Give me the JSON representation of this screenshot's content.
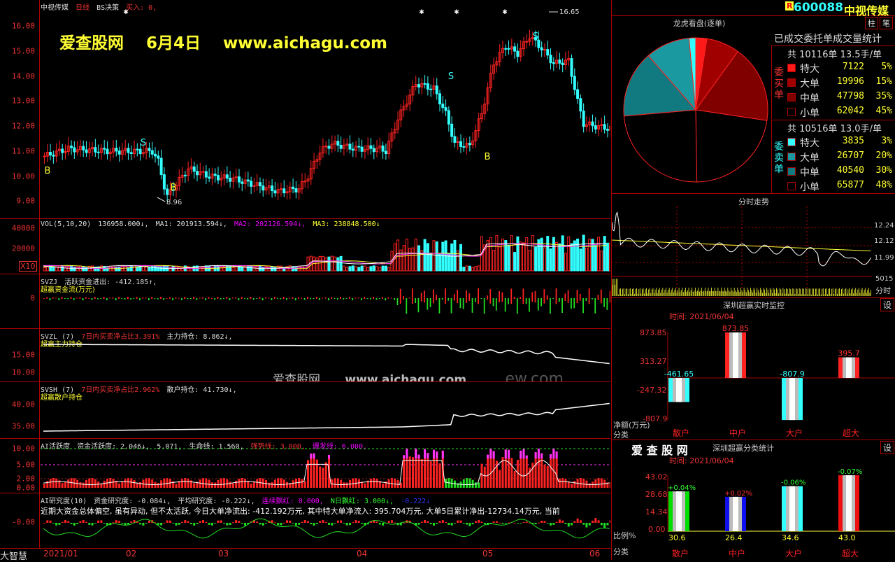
{
  "main_chart": {
    "stock_name": "中视传媒",
    "period": "日线",
    "strategy": "BS决策",
    "buy_text": "买入: 0,",
    "watermark_site": "爱查股网",
    "watermark_date": "6月4日",
    "watermark_url": "www.aichagu.com",
    "price_ticks": [
      "16.00",
      "15.00",
      "14.00",
      "13.00",
      "12.00",
      "11.00",
      "10.00",
      "9.00"
    ],
    "high_label": "16.65",
    "low_label": "8.96",
    "signals": [
      {
        "type": "B",
        "label": "B"
      },
      {
        "type": "B",
        "label": "B"
      },
      {
        "type": "S",
        "label": "S"
      },
      {
        "type": "S",
        "label": "S"
      },
      {
        "type": "B",
        "label": "B"
      },
      {
        "type": "S",
        "label": "S"
      }
    ]
  },
  "vol_pane": {
    "title": "VOL(5,10,20)",
    "value": "136958.000↓,",
    "ma1": "MA1: 201913.594↓,",
    "ma2": "MA2: 202126.594↓,",
    "ma3": "MA3: 238848.500↓",
    "ticks": [
      "40000",
      "20000"
    ],
    "unit": "X10"
  },
  "svzj_pane": {
    "title": "SVZJ",
    "line1": "活跃资金进出: -412.185↑,",
    "line2": "超赢资金流(万元)",
    "ticks": [
      "0"
    ]
  },
  "svzl_pane": {
    "title": "SVZL (7)",
    "ratio": "7日内买卖净占比3.391%",
    "hold": "主力持仓: 8.862↓,",
    "line2": "超赢主力持仓",
    "ticks": [
      "15.00",
      "10.00"
    ],
    "watermark": "爱查股网",
    "watermark_url": "www.aichagu.com",
    "watermark_faint": "ew.com"
  },
  "svsh_pane": {
    "title": "SVSH (7)",
    "ratio": "7日内买卖净占比2.962%",
    "hold": "散户持仓: 41.730↓,",
    "line2": "超赢散户持仓",
    "ticks": [
      "40.00",
      "35.00"
    ]
  },
  "ai_active_pane": {
    "title": "AI活跃度",
    "v1": "资金活跃度: 2.046↓,",
    "v2": "5.071,",
    "v3": "生命线: 1.560,",
    "v4": "强势线: 3.000,",
    "v5": "爆发线: 6.000,",
    "ticks": [
      "10.00",
      "5.00",
      "2.00",
      "0.00"
    ]
  },
  "ai_research_pane": {
    "title": "AI研究度(10)",
    "v1": "资金研究度: -0.084↓,",
    "v2": "平均研究度: -0.222↓,",
    "v3": "连续飘红: 0.000,",
    "v4": "N日飘红: 3.000↓,",
    "v5": "-0.222↓",
    "comment": "近期大资金总体偏空, 虽有异动, 但不太活跃, 今日大单净流出: -412.192万元, 其中特大单净流入: 395.704万元, 大单5日累计净出-12734.14万元, 当前",
    "ticks": [
      "-0.00"
    ]
  },
  "x_axis": {
    "app_label": "大智慧",
    "labels": [
      "2021/01",
      "02",
      "03",
      "04",
      "05",
      "06"
    ]
  },
  "right_header": {
    "badge": "R",
    "code": "600088",
    "name": "中视传媒",
    "btn1": "柱",
    "btn2": "笔"
  },
  "dragon_tiger": {
    "title": "龙虎看盘(逐单)",
    "subtitle": "已成交委托单成交量统计",
    "buy_header": "共 10116单 13.5手/单",
    "buy_side_label": "委买单",
    "buy_rows": [
      {
        "name": "特大",
        "count": "7122",
        "pct": "5%",
        "color": "#ff1a1a"
      },
      {
        "name": "大单",
        "count": "19996",
        "pct": "15%",
        "color": "#a00000"
      },
      {
        "name": "中单",
        "count": "47798",
        "pct": "35%",
        "color": "#800000"
      },
      {
        "name": "小单",
        "count": "62042",
        "pct": "45%",
        "color": "#000000"
      }
    ],
    "sell_header": "共 10516单 13.0手/单",
    "sell_side_label": "委卖单",
    "sell_rows": [
      {
        "name": "特大",
        "count": "3835",
        "pct": "3%",
        "color": "#33ffff"
      },
      {
        "name": "大单",
        "count": "26707",
        "pct": "20%",
        "color": "#1a9aa0"
      },
      {
        "name": "中单",
        "count": "40540",
        "pct": "30%",
        "color": "#107a80"
      },
      {
        "name": "小单",
        "count": "65877",
        "pct": "48%",
        "color": "#000000"
      }
    ]
  },
  "intraday": {
    "title": "分时走势",
    "ticks": [
      "12.24",
      "12.12",
      "11.99"
    ],
    "vol_tick": "5015",
    "vol_label": "分时"
  },
  "realtime_monitor": {
    "title": "深圳超赢实时监控",
    "setting_btn": "设",
    "time": "时间: 2021/06/04",
    "ticks": [
      "873.85",
      "313.27",
      "-247.32",
      "-807.9"
    ],
    "y_label": "净额(万元)",
    "x_label": "分类",
    "bars": [
      {
        "cat": "散户",
        "value": -461.65,
        "label": "-461.65"
      },
      {
        "cat": "中户",
        "value": 873.85,
        "label": "873.85"
      },
      {
        "cat": "大户",
        "value": -807.9,
        "label": "-807.9"
      },
      {
        "cat": "超大",
        "value": 395.7,
        "label": "395.7"
      }
    ]
  },
  "category_stats": {
    "watermark": "爱 查 股 网",
    "title": "深圳超赢分类统计",
    "setting_btn": "设",
    "time": "时间: 2021/06/04",
    "ticks": [
      "43.02",
      "28.68",
      "14.34",
      "0.00"
    ],
    "y_label": "比例%",
    "x_label": "分类",
    "bars": [
      {
        "cat": "散户",
        "value": 30.6,
        "top_label": "+0.04%",
        "bottom_label": "30.6",
        "color": "#00dd00"
      },
      {
        "cat": "中户",
        "value": 26.4,
        "top_label": "+0.02%",
        "bottom_label": "26.4",
        "color": "#1010ee"
      },
      {
        "cat": "大户",
        "value": 34.6,
        "top_label": "-0.06%",
        "bottom_label": "34.6",
        "color": "#33ffff"
      },
      {
        "cat": "超大",
        "value": 43.0,
        "top_label": "-0.07%",
        "bottom_label": "43.0",
        "color": "#ee1010"
      }
    ]
  }
}
